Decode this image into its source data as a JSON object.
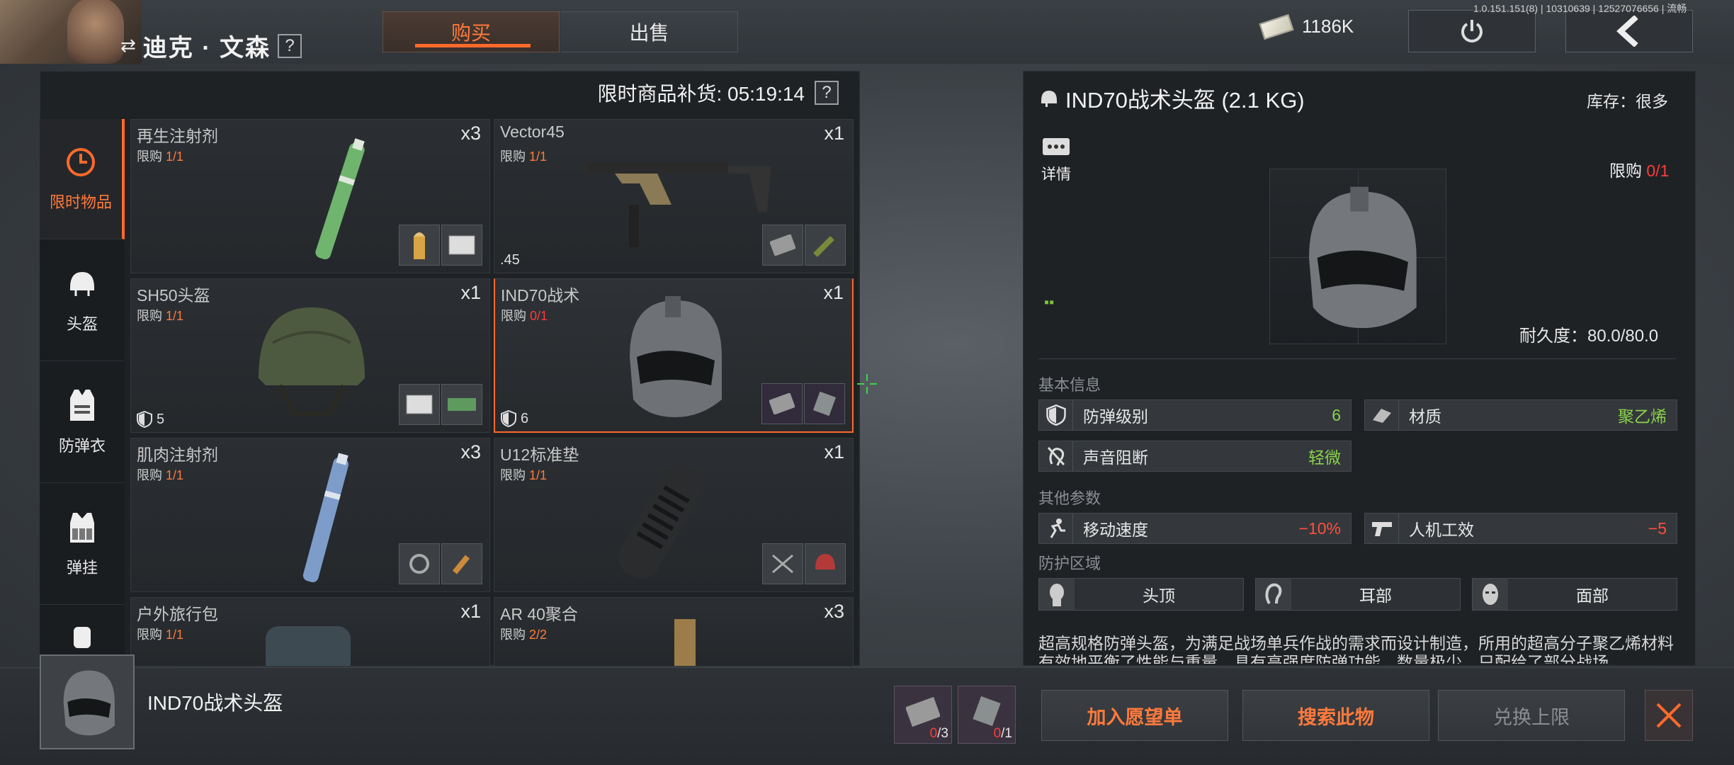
{
  "character": {
    "name": "迪克 · 文森",
    "help": "?"
  },
  "tabs": {
    "buy": "购买",
    "sell": "出售"
  },
  "currency": {
    "amount": "1186K"
  },
  "version": "1.0.151.151(8) | 10310639 | 12527076656 | 流畅",
  "shop": {
    "restock_label": "限时商品补货: 05:19:14",
    "help": "?",
    "categories": [
      {
        "label": "限时物品",
        "icon": "clock-icon",
        "active": true
      },
      {
        "label": "头盔",
        "icon": "helmet-icon"
      },
      {
        "label": "防弹衣",
        "icon": "vest-icon"
      },
      {
        "label": "弹挂",
        "icon": "chest-rig-icon"
      }
    ],
    "items": [
      {
        "name": "再生注射剂",
        "limit_prefix": "限购 ",
        "limit": "1/1",
        "qty": "x3",
        "foot": ""
      },
      {
        "name": "Vector45",
        "limit_prefix": "限购 ",
        "limit": "1/1",
        "qty": "x1",
        "foot": ".45"
      },
      {
        "name": "SH50头盔",
        "limit_prefix": "限购 ",
        "limit": "1/1",
        "qty": "x1",
        "foot": "5"
      },
      {
        "name": "IND70战术",
        "limit_prefix": "限购 ",
        "limit": "0/1",
        "qty": "x1",
        "foot": "6"
      },
      {
        "name": "肌肉注射剂",
        "limit_prefix": "限购 ",
        "limit": "1/1",
        "qty": "x3",
        "foot": ""
      },
      {
        "name": "U12标准垫",
        "limit_prefix": "限购 ",
        "limit": "1/1",
        "qty": "x1",
        "foot": ""
      },
      {
        "name": "户外旅行包",
        "limit_prefix": "限购 ",
        "limit": "1/1",
        "qty": "x1",
        "foot": ""
      },
      {
        "name": "AR 40聚合",
        "limit_prefix": "限购 ",
        "limit": "2/2",
        "qty": "x3",
        "foot": ""
      }
    ]
  },
  "detail": {
    "title": "IND70战术头盔 (2.1 KG)",
    "stock": "库存：很多",
    "details_label": "详情",
    "limit_prefix": "限购 ",
    "limit": "0/1",
    "durability": "耐久度：80.0/80.0",
    "basic_info": "基本信息",
    "stats_basic": [
      {
        "label": "防弹级别",
        "value": "6",
        "color": "green",
        "icon": "shield-icon"
      },
      {
        "label": "材质",
        "value": "聚乙烯",
        "color": "green",
        "icon": "material-icon"
      },
      {
        "label": "声音阻断",
        "value": "轻微",
        "color": "green",
        "icon": "ear-block-icon"
      }
    ],
    "other_params": "其他参数",
    "stats_other": [
      {
        "label": "移动速度",
        "value": "−10%",
        "color": "red",
        "icon": "running-icon"
      },
      {
        "label": "人机工效",
        "value": "−5",
        "color": "red",
        "icon": "pistol-icon"
      }
    ],
    "protect_area": "防护区域",
    "zones": [
      {
        "label": "头顶",
        "icon": "head-top-icon"
      },
      {
        "label": "耳部",
        "icon": "ear-icon"
      },
      {
        "label": "面部",
        "icon": "face-icon"
      }
    ],
    "description": "超高规格防弹头盔，为满足战场单兵作战的需求而设计制造，所用的超高分子聚乙烯材料有效地平衡了性能与重量，具有高强度防弹功能，数量极少，只配给了部分战场"
  },
  "bottom": {
    "name": "IND70战术头盔",
    "req1_have": "0",
    "req1_need": "/3",
    "req2_have": "0",
    "req2_need": "/1",
    "wishlist": "加入愿望单",
    "search": "搜索此物",
    "exchange": "兑换上限"
  }
}
